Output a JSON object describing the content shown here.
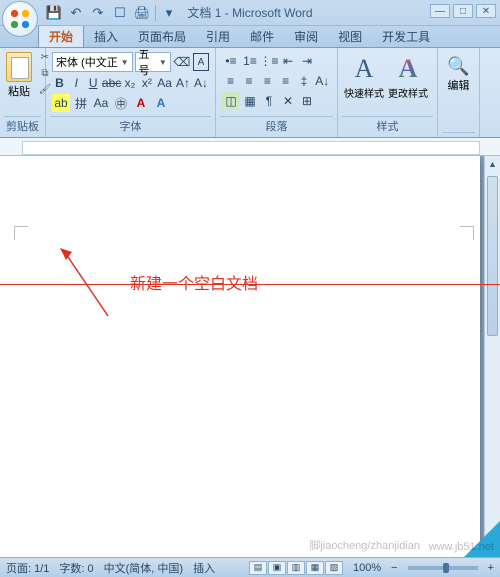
{
  "title": "文档 1 - Microsoft Word",
  "qat": {
    "save": "💾",
    "undo": "↶",
    "redo": "↷",
    "print": "🖨",
    "new": "☐"
  },
  "tabs": [
    "开始",
    "插入",
    "页面布局",
    "引用",
    "邮件",
    "审阅",
    "视图",
    "开发工具"
  ],
  "ribbon": {
    "clipboard": {
      "paste": "粘贴",
      "label": "剪贴板"
    },
    "font": {
      "name": "宋体 (中文正",
      "size": "五号",
      "label": "字体"
    },
    "paragraph": {
      "label": "段落"
    },
    "styles": {
      "quick": "快速样式",
      "change": "更改样式",
      "label": "样式"
    },
    "editing": {
      "label": "编辑"
    }
  },
  "annotation": "新建一个空白文档",
  "status": {
    "page": "页面: 1/1",
    "words": "字数: 0",
    "lang": "中文(简体, 中国)",
    "mode": "插入",
    "zoom": "100%"
  },
  "watermark": "www.jb51.net",
  "watermark2": "脚jiaocheng/zhanjidian"
}
